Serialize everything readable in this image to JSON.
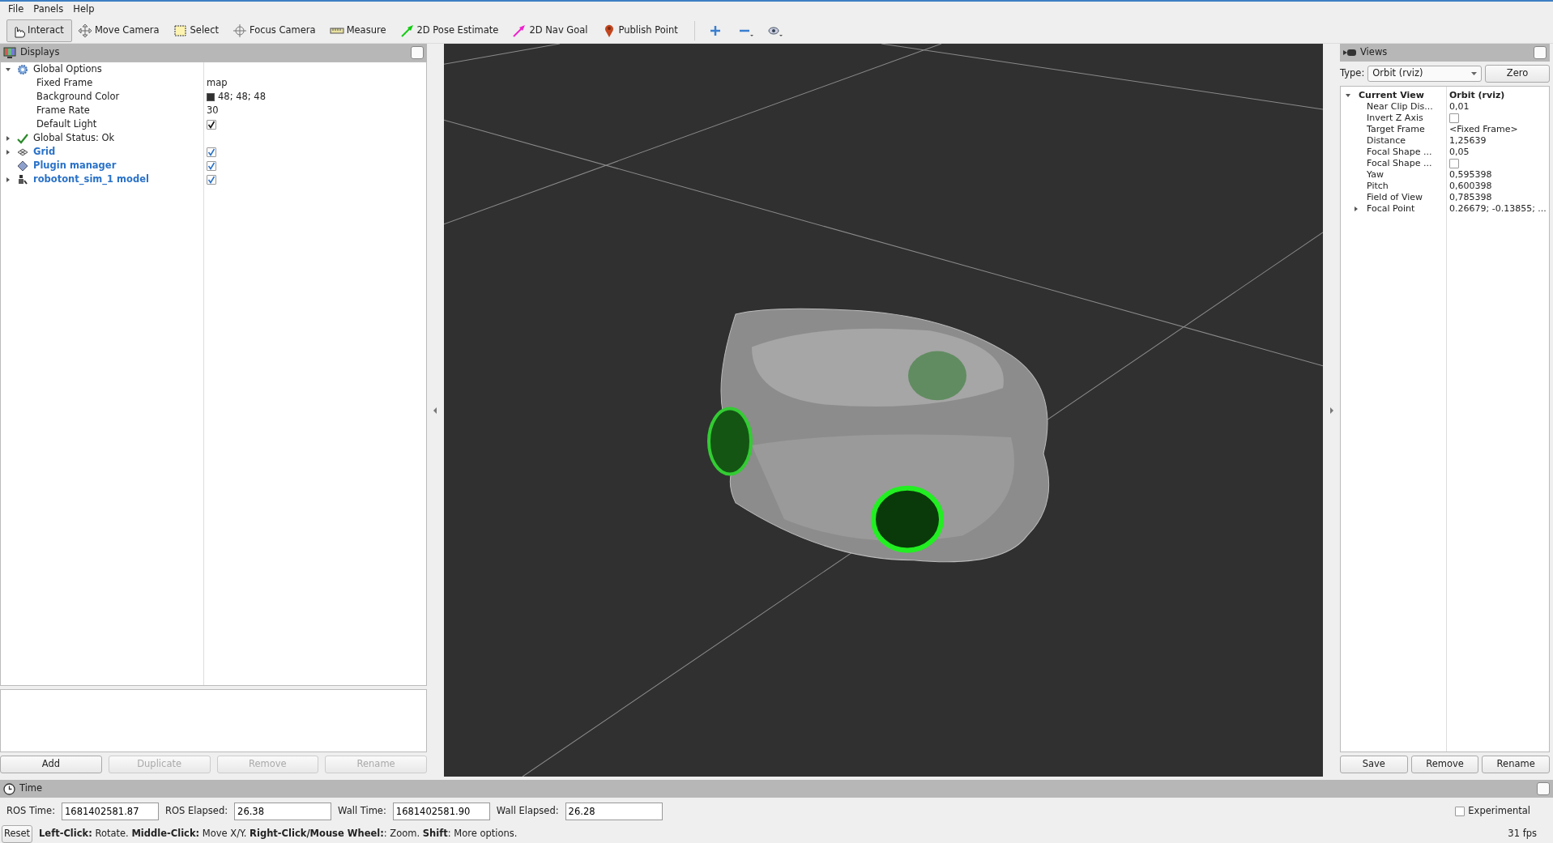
{
  "menu": [
    {
      "label": "File"
    },
    {
      "label": "Panels"
    },
    {
      "label": "Help"
    }
  ],
  "toolbar": {
    "tools": [
      {
        "label": "Interact",
        "selected": true
      },
      {
        "label": "Move Camera",
        "selected": false
      },
      {
        "label": "Select",
        "selected": false
      },
      {
        "label": "Focus Camera",
        "selected": false
      },
      {
        "label": "Measure",
        "selected": false
      },
      {
        "label": "2D Pose Estimate",
        "selected": false
      },
      {
        "label": "2D Nav Goal",
        "selected": false
      },
      {
        "label": "Publish Point",
        "selected": false
      }
    ]
  },
  "displays": {
    "title": "Displays",
    "items": [
      {
        "kind": "options",
        "label": "Global Options",
        "expanded": true,
        "children": [
          {
            "label": "Fixed Frame",
            "value": "map"
          },
          {
            "label": "Background Color",
            "value": "48; 48; 48",
            "color": "#303030"
          },
          {
            "label": "Frame Rate",
            "value": "30"
          },
          {
            "label": "Default Light",
            "checked": true
          }
        ]
      },
      {
        "kind": "status",
        "label": "Global Status: Ok",
        "expanded": false
      },
      {
        "kind": "grid",
        "label": "Grid",
        "expanded": false,
        "checked": true
      },
      {
        "kind": "plugin",
        "label": "Plugin manager",
        "checked": true
      },
      {
        "kind": "robot",
        "label": "robotont_sim_1 model",
        "expanded": false,
        "checked": true
      }
    ],
    "buttons": [
      {
        "label": "Add",
        "disabled": false
      },
      {
        "label": "Duplicate",
        "disabled": true
      },
      {
        "label": "Remove",
        "disabled": true
      },
      {
        "label": "Rename",
        "disabled": true
      }
    ]
  },
  "views": {
    "title": "Views",
    "type_label": "Type:",
    "type_value": "Orbit (rviz)",
    "zero_button": "Zero",
    "current": {
      "label": "Current View",
      "value": "Orbit (rviz)",
      "expanded": true,
      "children": [
        {
          "label": "Near Clip Dis...",
          "value": "0,01"
        },
        {
          "label": "Invert Z Axis",
          "checked": false
        },
        {
          "label": "Target Frame",
          "value": "<Fixed Frame>"
        },
        {
          "label": "Distance",
          "value": "1,25639"
        },
        {
          "label": "Focal Shape ...",
          "value": "0,05"
        },
        {
          "label": "Focal Shape ...",
          "checked": false
        },
        {
          "label": "Yaw",
          "value": "0,595398"
        },
        {
          "label": "Pitch",
          "value": "0,600398"
        },
        {
          "label": "Field of View",
          "value": "0,785398"
        },
        {
          "label": "Focal Point",
          "value": "0.26679; -0.13855; ...",
          "expanded": false
        }
      ]
    },
    "buttons": [
      {
        "label": "Save"
      },
      {
        "label": "Remove"
      },
      {
        "label": "Rename"
      }
    ]
  },
  "time": {
    "title": "Time",
    "fields": [
      {
        "label": "ROS Time:",
        "value": "1681402581.87"
      },
      {
        "label": "ROS Elapsed:",
        "value": "26.38"
      },
      {
        "label": "Wall Time:",
        "value": "1681402581.90"
      },
      {
        "label": "Wall Elapsed:",
        "value": "26.28"
      }
    ],
    "experimental": {
      "label": "Experimental",
      "checked": false
    }
  },
  "status": {
    "reset": "Reset",
    "hint": "**Left-Click:** Rotate. **Middle-Click:** Move X/Y. **Right-Click/Mouse Wheel:**: Zoom. **Shift**: More options.",
    "fps": "31 fps"
  }
}
